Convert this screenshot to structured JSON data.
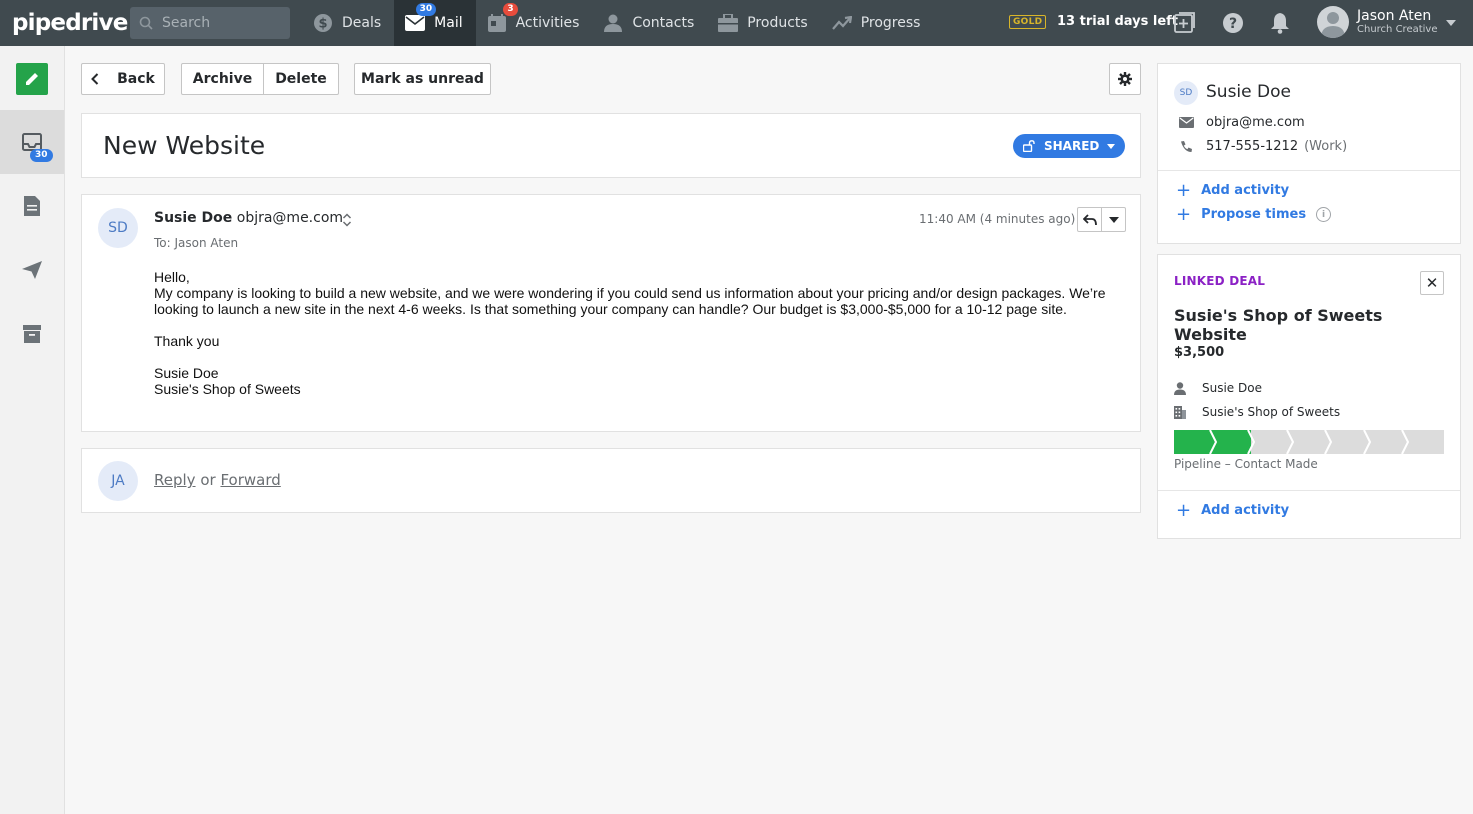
{
  "brand": "pipedrive",
  "search": {
    "placeholder": "Search"
  },
  "nav": [
    {
      "label": "Deals",
      "icon": "dollar-icon"
    },
    {
      "label": "Mail",
      "icon": "mail-icon",
      "badge": "30",
      "active": true
    },
    {
      "label": "Activities",
      "icon": "calendar-icon",
      "badge": "3"
    },
    {
      "label": "Contacts",
      "icon": "person-icon"
    },
    {
      "label": "Products",
      "icon": "box-icon"
    },
    {
      "label": "Progress",
      "icon": "trend-icon"
    }
  ],
  "plan": {
    "badge": "GOLD",
    "trial": "13 trial days left"
  },
  "user": {
    "name": "Jason Aten",
    "company": "Church Creative"
  },
  "sidebar": {
    "inbox_badge": "30"
  },
  "toolbar": {
    "back": "Back",
    "archive": "Archive",
    "delete": "Delete",
    "mark_unread": "Mark as unread"
  },
  "thread": {
    "subject": "New Website",
    "shared": "SHARED"
  },
  "message": {
    "avatar": "SD",
    "from_name": "Susie Doe",
    "from_email": "objra@me.com",
    "to": "To: Jason Aten",
    "time": "11:40 AM (4 minutes ago)",
    "body": {
      "greeting": "Hello,",
      "line1": "My company is looking to build a new website, and we were wondering if you could send us information about your pricing and/or design packages. We’re",
      "line2": "looking to launch a new site in the next 4-6 weeks. Is that something your company can handle? Our budget is $3,000-$5,000 for a 10-12 page site.",
      "thanks": "Thank you",
      "sig1": "Susie Doe",
      "sig2": "Susie's Shop of Sweets"
    }
  },
  "reply": {
    "avatar": "JA",
    "reply": "Reply",
    "or": "or",
    "forward": "Forward"
  },
  "contact": {
    "avatar": "SD",
    "name": "Susie Doe",
    "email": "objra@me.com",
    "phone": "517-555-1212",
    "phone_type": "(Work)",
    "add_activity": "Add activity",
    "propose_times": "Propose times"
  },
  "linked_deal": {
    "label": "LINKED DEAL",
    "title": "Susie's Shop of Sweets Website",
    "value": "$3,500",
    "person": "Susie Doe",
    "org": "Susie's Shop of Sweets",
    "stages_total": 7,
    "stages_done": 2,
    "pipeline": "Pipeline – Contact Made",
    "add_activity": "Add activity"
  },
  "colors": {
    "topbar": "#404a4f",
    "accent": "#317ae2",
    "success": "#24b34c",
    "linked_label": "#8b21c5"
  }
}
